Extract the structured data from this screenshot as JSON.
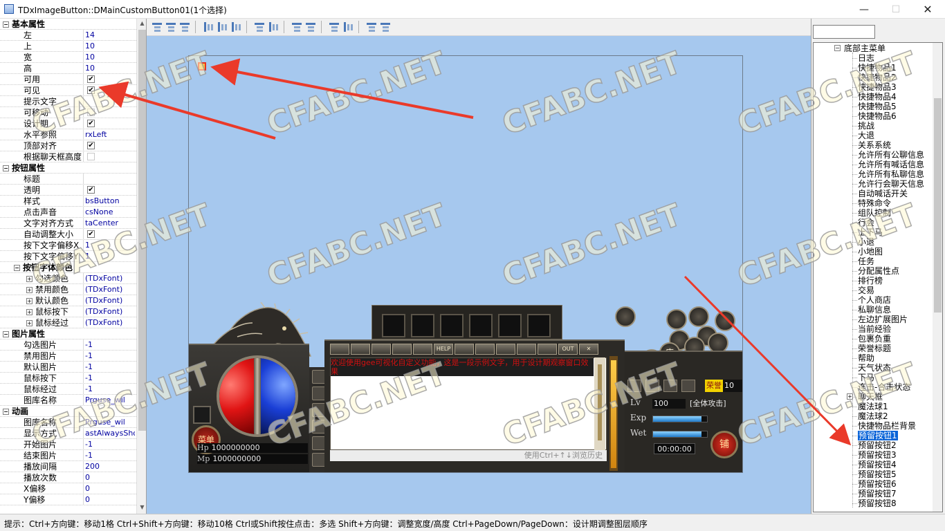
{
  "window": {
    "title": "TDxImageButton::DMainCustomButton01(1个选择)",
    "min_glyph": "—",
    "max_glyph": "☐",
    "close_glyph": "✕"
  },
  "inspector": {
    "rows": [
      {
        "type": "group",
        "name": "基本属性",
        "expander": "⊟"
      },
      {
        "type": "prop",
        "name": "左",
        "value": "14"
      },
      {
        "type": "prop",
        "name": "上",
        "value": "10"
      },
      {
        "type": "prop",
        "name": "宽",
        "value": "10"
      },
      {
        "type": "prop",
        "name": "高",
        "value": "10"
      },
      {
        "type": "check",
        "name": "可用",
        "checked": true
      },
      {
        "type": "check",
        "name": "可见",
        "checked": true
      },
      {
        "type": "prop",
        "name": "提示文字",
        "value": ""
      },
      {
        "type": "check",
        "name": "可移动",
        "checked": false
      },
      {
        "type": "check",
        "name": "设计期",
        "checked": true
      },
      {
        "type": "prop",
        "name": "水平参照",
        "value": "rxLeft"
      },
      {
        "type": "check",
        "name": "顶部对齐",
        "checked": true
      },
      {
        "type": "check",
        "name": "根据聊天框高度",
        "checked": false
      },
      {
        "type": "group",
        "name": "按钮属性",
        "expander": "⊟"
      },
      {
        "type": "prop",
        "name": "标题",
        "value": ""
      },
      {
        "type": "check",
        "name": "透明",
        "checked": true
      },
      {
        "type": "prop",
        "name": "样式",
        "value": "bsButton"
      },
      {
        "type": "prop",
        "name": "点击声音",
        "value": "csNone"
      },
      {
        "type": "prop",
        "name": "文字对齐方式",
        "value": "taCenter"
      },
      {
        "type": "check",
        "name": "自动调整大小",
        "checked": true
      },
      {
        "type": "prop",
        "name": "按下文字偏移X",
        "value": "1"
      },
      {
        "type": "prop",
        "name": "按下文字偏移Y",
        "value": "1"
      },
      {
        "type": "subgroup",
        "name": "按钮字体颜色",
        "expander": "⊟"
      },
      {
        "type": "font",
        "name": "勾选颜色",
        "value": "(TDxFont)",
        "expander": "⊞"
      },
      {
        "type": "font",
        "name": "禁用颜色",
        "value": "(TDxFont)",
        "expander": "⊞"
      },
      {
        "type": "font",
        "name": "默认颜色",
        "value": "(TDxFont)",
        "expander": "⊞"
      },
      {
        "type": "font",
        "name": "鼠标按下",
        "value": "(TDxFont)",
        "expander": "⊞"
      },
      {
        "type": "font",
        "name": "鼠标经过",
        "value": "(TDxFont)",
        "expander": "⊞"
      },
      {
        "type": "group",
        "name": "图片属性",
        "expander": "⊟"
      },
      {
        "type": "prop",
        "name": "勾选图片",
        "value": "-1"
      },
      {
        "type": "prop",
        "name": "禁用图片",
        "value": "-1"
      },
      {
        "type": "prop",
        "name": "默认图片",
        "value": "-1"
      },
      {
        "type": "prop",
        "name": "鼠标按下",
        "value": "-1"
      },
      {
        "type": "prop",
        "name": "鼠标经过",
        "value": "-1"
      },
      {
        "type": "prop",
        "name": "图库名称",
        "value": "Prguse_wil"
      },
      {
        "type": "group",
        "name": "动画",
        "expander": "⊟"
      },
      {
        "type": "prop",
        "name": "图库名称",
        "value": "Prguse_wil"
      },
      {
        "type": "prop",
        "name": "显示方式",
        "value": "astAlwaysShow"
      },
      {
        "type": "prop",
        "name": "开始图片",
        "value": "-1"
      },
      {
        "type": "prop",
        "name": "结束图片",
        "value": "-1"
      },
      {
        "type": "prop",
        "name": "播放间隔",
        "value": "200"
      },
      {
        "type": "prop",
        "name": "播放次数",
        "value": "0"
      },
      {
        "type": "prop",
        "name": "X偏移",
        "value": "0"
      },
      {
        "type": "prop",
        "name": "Y偏移",
        "value": "0"
      }
    ],
    "check_glyph": "✔",
    "scroll_up": "▲",
    "scroll_down": "▼"
  },
  "toolbar": {
    "buttons": [
      "align-left",
      "align-center-h",
      "align-right",
      "align-top",
      "align-middle-v",
      "align-bottom",
      "space-h",
      "space-v",
      "size-width-help",
      "size-height-help",
      "same-width",
      "same-height",
      "bring-front",
      "send-back"
    ]
  },
  "hud": {
    "menu_label": "菜单",
    "hp_label": "Hp",
    "hp_value": "1000000000",
    "mp_label": "Mp",
    "mp_value": "1000000000",
    "chat_buttons": [
      "",
      "",
      "",
      "",
      "",
      "HELP",
      "",
      "",
      "",
      "",
      "",
      "OUT",
      "✕"
    ],
    "chat_message": "欢迎使用gee可视化自定义功能，这是一段示例文字，用于设计期观察窗口效果",
    "chat_hint": "使用Ctrl+↑↓浏览历史",
    "honor_tag": "荣誉",
    "honor_value": "10",
    "lv_label": "Lv",
    "lv_value": "100",
    "attack_mode": "[全体攻击]",
    "exp_label": "Exp",
    "exp_fill": 0.9,
    "wet_label": "Wet",
    "wet_fill": 0.9,
    "clock": "00:00:00",
    "shop_label": "铺",
    "round_icons": [
      "",
      "",
      "",
      "",
      "",
      "",
      "e",
      "店",
      "",
      ""
    ]
  },
  "watermark": "CFABC.NET",
  "tree": {
    "search_value": "",
    "root": "底部主菜单",
    "items": [
      "日志",
      "快捷物品1",
      "快捷物品2",
      "快捷物品3",
      "快捷物品4",
      "快捷物品5",
      "快捷物品6",
      "挑战",
      "大退",
      "关系系统",
      "允许所有公聊信息",
      "允许所有喊话信息",
      "允许所有私聊信息",
      "允许行会聊天信息",
      "自动喊话开关",
      "特殊命令",
      "组队控制",
      "行会",
      "上下马",
      "小退",
      "小地图",
      "任务",
      "分配属性点",
      "排行榜",
      "交易",
      "个人商店",
      "私聊信息",
      "左边扩展图片",
      "当前经验",
      "包裹负重",
      "荣誉标题",
      "帮助",
      "天气状态",
      "下马",
      "连击-合击状态",
      "聊天框",
      "魔法球1",
      "魔法球2",
      "快捷物品栏背景",
      "预留按钮1",
      "预留按钮2",
      "预留按钮3",
      "预留按钮4",
      "预留按钮5",
      "预留按钮6",
      "预留按钮7",
      "预留按钮8"
    ],
    "selected": "预留按钮1",
    "expanded_child": "聊天框",
    "collapse_glyph": "⊟",
    "expand_glyph": "⊞"
  },
  "statusbar": {
    "text": "提示：Ctrl+方向键：移动1格    Ctrl+Shift+方向键：移动10格    Ctrl或Shift按住点击：多选    Shift+方向键：调整宽度/高度    Ctrl+PageDown/PageDown：设计期调整图层顺序"
  }
}
